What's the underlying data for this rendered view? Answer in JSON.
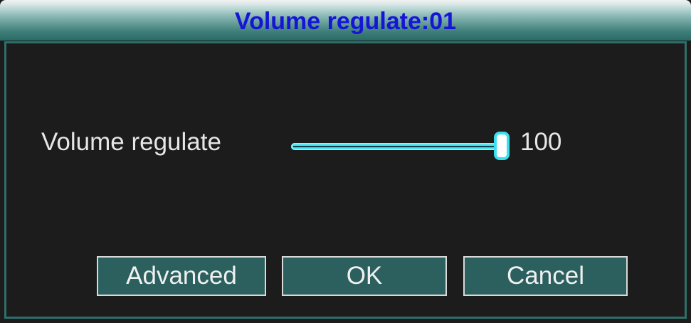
{
  "dialog": {
    "title": "Volume regulate:01"
  },
  "volume": {
    "label": "Volume regulate",
    "value": "100",
    "level_percent": 100
  },
  "buttons": {
    "advanced": "Advanced",
    "ok": "OK",
    "cancel": "Cancel"
  },
  "colors": {
    "title_text": "#1515d8",
    "accent": "#39e0f0",
    "button_bg": "#2b605e",
    "background": "#1c1c1c"
  }
}
